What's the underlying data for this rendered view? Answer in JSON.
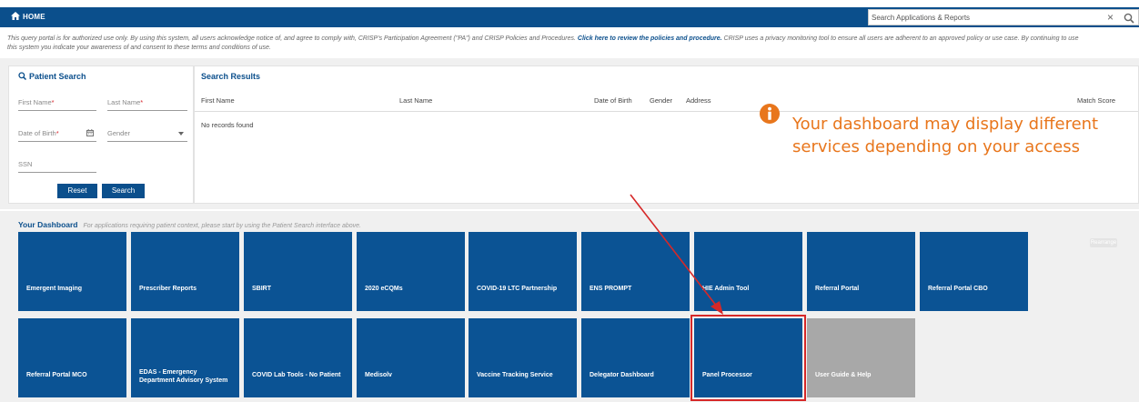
{
  "nav": {
    "home_label": "HOME",
    "search_placeholder": "Search Applications & Reports",
    "clear_symbol": "×"
  },
  "disclaimer": {
    "before_link": "This query portal is for authorized use only. By using this system, all users acknowledge notice of, and agree to comply with, CRISP's Participation Agreement (\"PA\") and CRISP Policies and Procedures. ",
    "link": "Click here to review the policies and procedure.",
    "after_link": " CRISP uses a privacy monitoring tool to ensure all users are adherent to an approved policy or use case. By continuing to use",
    "line2": "this system you indicate your awareness of and consent to these terms and conditions of use."
  },
  "patient_search": {
    "title": "Patient Search",
    "first_name_label": "First Name",
    "last_name_label": "Last Name",
    "dob_label": "Date of Birth",
    "gender_label": "Gender",
    "ssn_label": "SSN",
    "required_mark": "*",
    "reset_label": "Reset",
    "search_label": "Search"
  },
  "search_results": {
    "title": "Search Results",
    "columns": [
      "First Name",
      "Last Name",
      "Date of Birth",
      "Gender",
      "Address",
      "Match Score"
    ],
    "empty_message": "No records found"
  },
  "callout": {
    "text": "Your dashboard may display different services depending on your access"
  },
  "dashboard": {
    "title": "Your Dashboard",
    "hint": "For applications requiring patient context, please start by using the Patient Search interface above.",
    "rearrange_label": "Rearrange",
    "row1": [
      "Emergent Imaging",
      "Prescriber Reports",
      "SBIRT",
      "2020 eCQMs",
      "COVID-19 LTC Partnership",
      "ENS PROMPT",
      "HIE Admin Tool",
      "Referral Portal",
      "Referral Portal CBO"
    ],
    "row2": [
      "Referral Portal MCO",
      "EDAS - Emergency Department Advisory System",
      "COVID Lab Tools - No Patient",
      "Medisolv",
      "Vaccine Tracking Service",
      "Delegator Dashboard",
      "Panel Processor",
      "User Guide & Help"
    ],
    "highlighted_tile": "Panel Processor",
    "disabled_tile": "User Guide & Help"
  },
  "colors": {
    "brand_blue": "#0b4f8c",
    "tile_blue": "#0b5394",
    "tile_gray": "#a8a8a8",
    "callout_orange": "#e8761c",
    "highlight_red": "#d62828"
  }
}
